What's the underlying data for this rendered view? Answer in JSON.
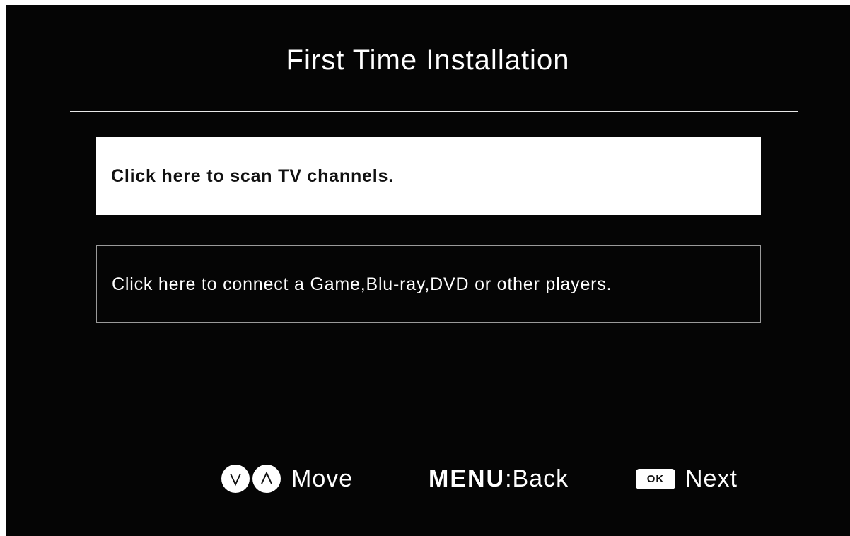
{
  "header": {
    "title": "First Time Installation"
  },
  "options": [
    {
      "label": "Click here to scan TV channels.",
      "selected": true
    },
    {
      "label": "Click here to connect a Game,Blu-ray,DVD or other players.",
      "selected": false
    }
  ],
  "footer": {
    "move_label": "Move",
    "menu_key": "MENU",
    "back_label": ":Back",
    "ok_key": "OK",
    "next_label": "Next"
  },
  "icons": {
    "down": "chevron-down-icon",
    "up": "chevron-up-icon",
    "ok": "ok-key-icon"
  },
  "colors": {
    "background": "#050505",
    "text": "#ffffff",
    "selected_bg": "#ffffff",
    "selected_text": "#111111",
    "border": "#9a9a9a"
  }
}
